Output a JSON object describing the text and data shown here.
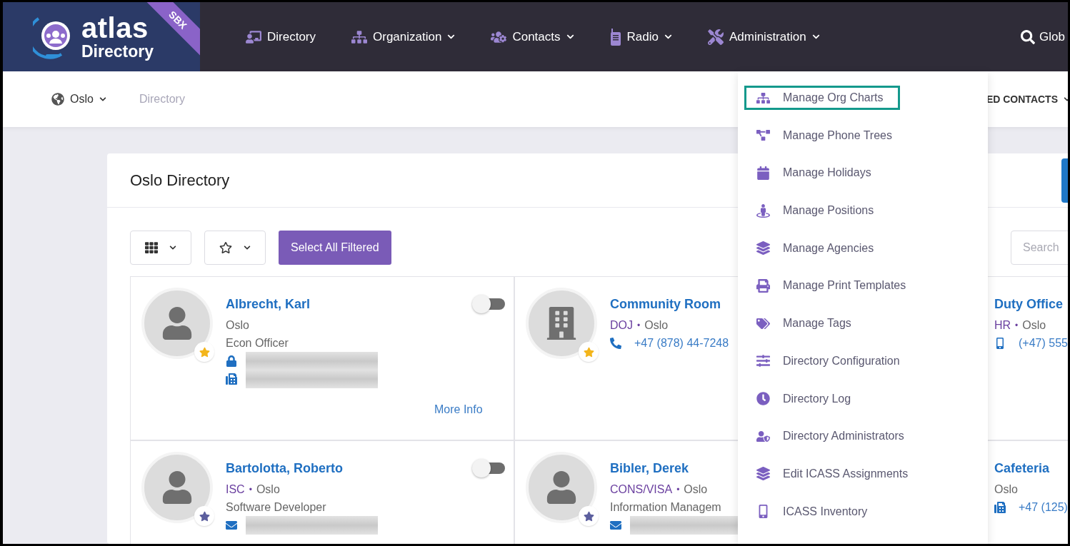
{
  "brand": {
    "name": "atlas",
    "product": "Directory",
    "badge": "SBX"
  },
  "nav": [
    {
      "label": "Directory",
      "has_menu": false
    },
    {
      "label": "Organization",
      "has_menu": true
    },
    {
      "label": "Contacts",
      "has_menu": true
    },
    {
      "label": "Radio",
      "has_menu": true
    },
    {
      "label": "Administration",
      "has_menu": true,
      "expanded": true
    }
  ],
  "global_search": {
    "label": "Glob"
  },
  "location": {
    "label": "Oslo"
  },
  "breadcrumb": "Directory",
  "contacts_menu": {
    "label": "ED CONTACTS"
  },
  "panel": {
    "title": "Oslo Directory",
    "select_all": "Select All Filtered",
    "search": {
      "placeholder": "Search"
    }
  },
  "contacts": [
    {
      "kind": "person",
      "name": "Albrecht, Karl",
      "location": "Oslo",
      "title": "Econ Officer",
      "favorite": true,
      "toggle": {
        "on": false
      },
      "lines": [
        {
          "kind": "lock"
        },
        {
          "kind": "fax"
        }
      ],
      "more_info": "More Info"
    },
    {
      "kind": "room",
      "name": "Community Room",
      "agency": "DOJ",
      "separator": "•",
      "location": "Oslo",
      "favorite": true,
      "lines": [
        {
          "kind": "phone",
          "value": "+47 (878) 44-7248"
        }
      ]
    },
    {
      "kind": "hidden",
      "name": "Duty Office",
      "agency": "HR",
      "separator": "•",
      "location": "Oslo",
      "lines": [
        {
          "kind": "mobile",
          "value": "(+47) 555"
        }
      ]
    },
    {
      "kind": "person",
      "name": "Bartolotta, Roberto",
      "agency": "ISC",
      "separator": "•",
      "location": "Oslo",
      "title": "Software Developer",
      "favorite": false,
      "toggle": {
        "on": false
      },
      "lines": [
        {
          "kind": "email"
        }
      ]
    },
    {
      "kind": "person",
      "name": "Bibler, Derek",
      "agency": "CONS/VISA",
      "separator": "•",
      "location": "Oslo",
      "title": "Information Managem",
      "favorite": false,
      "lines": [
        {
          "kind": "email"
        }
      ]
    },
    {
      "kind": "hidden",
      "name": "Cafeteria",
      "location": "Oslo",
      "lines": [
        {
          "kind": "fax",
          "value": "+47 (125)"
        }
      ]
    }
  ],
  "admin_menu": [
    {
      "label": "Manage Org Charts",
      "selected": true
    },
    {
      "label": "Manage Phone Trees",
      "selected": false
    },
    {
      "label": "Manage Holidays",
      "selected": false
    },
    {
      "label": "Manage Positions",
      "selected": false
    },
    {
      "label": "Manage Agencies",
      "selected": false
    },
    {
      "label": "Manage Print Templates",
      "selected": false
    },
    {
      "label": "Manage Tags",
      "selected": false
    },
    {
      "label": "Directory Configuration",
      "selected": false
    },
    {
      "label": "Directory Log",
      "selected": false
    },
    {
      "label": "Directory Administrators",
      "selected": false
    },
    {
      "label": "Edit ICASS Assignments",
      "selected": false
    },
    {
      "label": "ICASS Inventory",
      "selected": false
    }
  ]
}
